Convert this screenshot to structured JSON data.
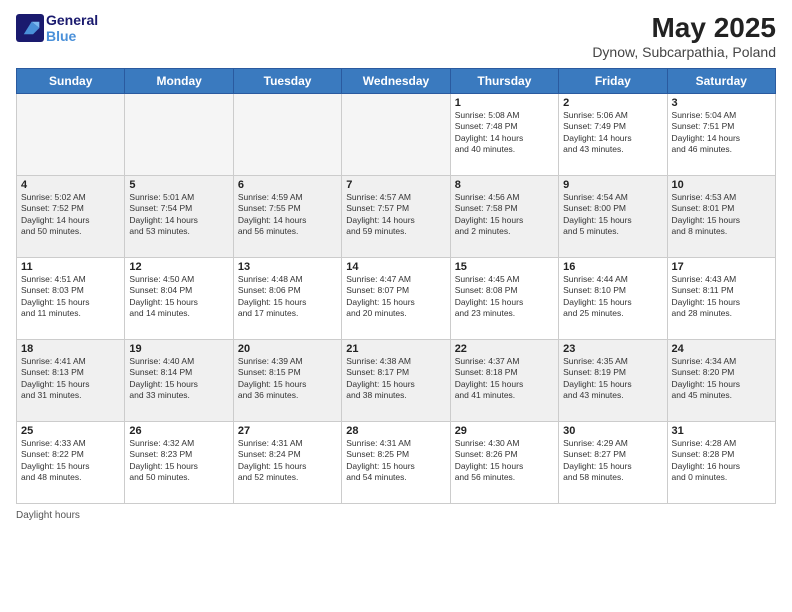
{
  "header": {
    "logo_line1": "General",
    "logo_line2": "Blue",
    "month_title": "May 2025",
    "location": "Dynow, Subcarpathia, Poland"
  },
  "days_of_week": [
    "Sunday",
    "Monday",
    "Tuesday",
    "Wednesday",
    "Thursday",
    "Friday",
    "Saturday"
  ],
  "weeks": [
    [
      {
        "day": "",
        "info": ""
      },
      {
        "day": "",
        "info": ""
      },
      {
        "day": "",
        "info": ""
      },
      {
        "day": "",
        "info": ""
      },
      {
        "day": "1",
        "info": "Sunrise: 5:08 AM\nSunset: 7:48 PM\nDaylight: 14 hours\nand 40 minutes."
      },
      {
        "day": "2",
        "info": "Sunrise: 5:06 AM\nSunset: 7:49 PM\nDaylight: 14 hours\nand 43 minutes."
      },
      {
        "day": "3",
        "info": "Sunrise: 5:04 AM\nSunset: 7:51 PM\nDaylight: 14 hours\nand 46 minutes."
      }
    ],
    [
      {
        "day": "4",
        "info": "Sunrise: 5:02 AM\nSunset: 7:52 PM\nDaylight: 14 hours\nand 50 minutes."
      },
      {
        "day": "5",
        "info": "Sunrise: 5:01 AM\nSunset: 7:54 PM\nDaylight: 14 hours\nand 53 minutes."
      },
      {
        "day": "6",
        "info": "Sunrise: 4:59 AM\nSunset: 7:55 PM\nDaylight: 14 hours\nand 56 minutes."
      },
      {
        "day": "7",
        "info": "Sunrise: 4:57 AM\nSunset: 7:57 PM\nDaylight: 14 hours\nand 59 minutes."
      },
      {
        "day": "8",
        "info": "Sunrise: 4:56 AM\nSunset: 7:58 PM\nDaylight: 15 hours\nand 2 minutes."
      },
      {
        "day": "9",
        "info": "Sunrise: 4:54 AM\nSunset: 8:00 PM\nDaylight: 15 hours\nand 5 minutes."
      },
      {
        "day": "10",
        "info": "Sunrise: 4:53 AM\nSunset: 8:01 PM\nDaylight: 15 hours\nand 8 minutes."
      }
    ],
    [
      {
        "day": "11",
        "info": "Sunrise: 4:51 AM\nSunset: 8:03 PM\nDaylight: 15 hours\nand 11 minutes."
      },
      {
        "day": "12",
        "info": "Sunrise: 4:50 AM\nSunset: 8:04 PM\nDaylight: 15 hours\nand 14 minutes."
      },
      {
        "day": "13",
        "info": "Sunrise: 4:48 AM\nSunset: 8:06 PM\nDaylight: 15 hours\nand 17 minutes."
      },
      {
        "day": "14",
        "info": "Sunrise: 4:47 AM\nSunset: 8:07 PM\nDaylight: 15 hours\nand 20 minutes."
      },
      {
        "day": "15",
        "info": "Sunrise: 4:45 AM\nSunset: 8:08 PM\nDaylight: 15 hours\nand 23 minutes."
      },
      {
        "day": "16",
        "info": "Sunrise: 4:44 AM\nSunset: 8:10 PM\nDaylight: 15 hours\nand 25 minutes."
      },
      {
        "day": "17",
        "info": "Sunrise: 4:43 AM\nSunset: 8:11 PM\nDaylight: 15 hours\nand 28 minutes."
      }
    ],
    [
      {
        "day": "18",
        "info": "Sunrise: 4:41 AM\nSunset: 8:13 PM\nDaylight: 15 hours\nand 31 minutes."
      },
      {
        "day": "19",
        "info": "Sunrise: 4:40 AM\nSunset: 8:14 PM\nDaylight: 15 hours\nand 33 minutes."
      },
      {
        "day": "20",
        "info": "Sunrise: 4:39 AM\nSunset: 8:15 PM\nDaylight: 15 hours\nand 36 minutes."
      },
      {
        "day": "21",
        "info": "Sunrise: 4:38 AM\nSunset: 8:17 PM\nDaylight: 15 hours\nand 38 minutes."
      },
      {
        "day": "22",
        "info": "Sunrise: 4:37 AM\nSunset: 8:18 PM\nDaylight: 15 hours\nand 41 minutes."
      },
      {
        "day": "23",
        "info": "Sunrise: 4:35 AM\nSunset: 8:19 PM\nDaylight: 15 hours\nand 43 minutes."
      },
      {
        "day": "24",
        "info": "Sunrise: 4:34 AM\nSunset: 8:20 PM\nDaylight: 15 hours\nand 45 minutes."
      }
    ],
    [
      {
        "day": "25",
        "info": "Sunrise: 4:33 AM\nSunset: 8:22 PM\nDaylight: 15 hours\nand 48 minutes."
      },
      {
        "day": "26",
        "info": "Sunrise: 4:32 AM\nSunset: 8:23 PM\nDaylight: 15 hours\nand 50 minutes."
      },
      {
        "day": "27",
        "info": "Sunrise: 4:31 AM\nSunset: 8:24 PM\nDaylight: 15 hours\nand 52 minutes."
      },
      {
        "day": "28",
        "info": "Sunrise: 4:31 AM\nSunset: 8:25 PM\nDaylight: 15 hours\nand 54 minutes."
      },
      {
        "day": "29",
        "info": "Sunrise: 4:30 AM\nSunset: 8:26 PM\nDaylight: 15 hours\nand 56 minutes."
      },
      {
        "day": "30",
        "info": "Sunrise: 4:29 AM\nSunset: 8:27 PM\nDaylight: 15 hours\nand 58 minutes."
      },
      {
        "day": "31",
        "info": "Sunrise: 4:28 AM\nSunset: 8:28 PM\nDaylight: 16 hours\nand 0 minutes."
      }
    ]
  ],
  "footer": {
    "label": "Daylight hours"
  }
}
